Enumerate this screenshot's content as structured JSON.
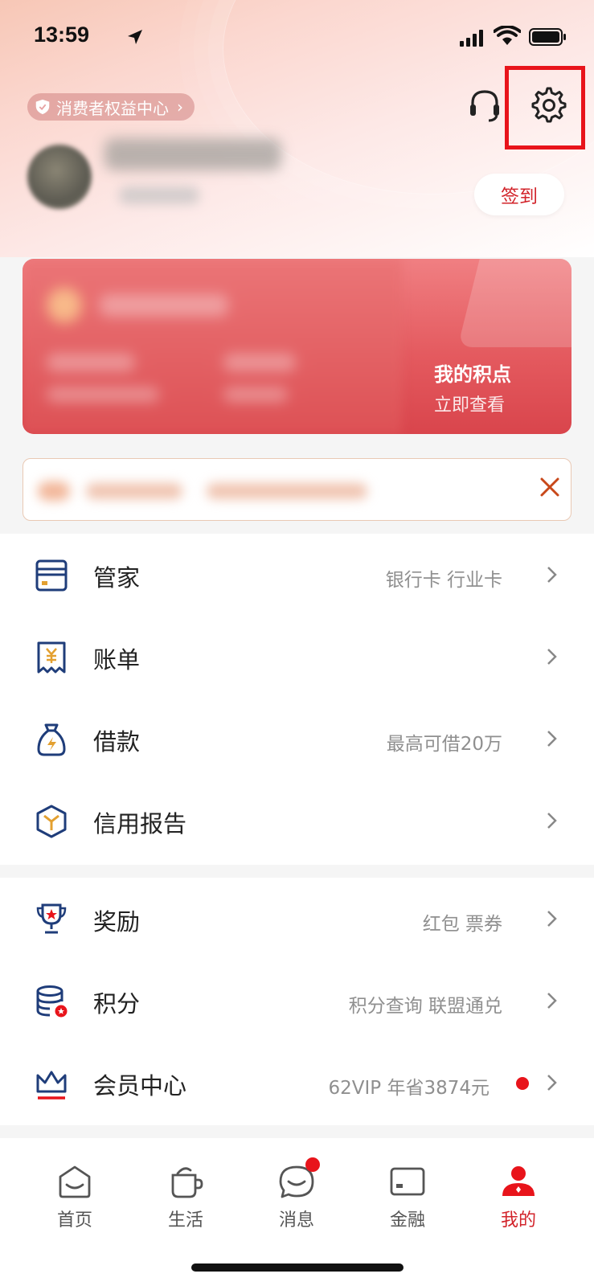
{
  "status_bar": {
    "time": "13:59"
  },
  "header": {
    "consumer_badge": "消费者权益中心",
    "checkin_label": "签到"
  },
  "points_card": {
    "title": "我的积点",
    "subtitle": "立即查看"
  },
  "menu_group_1": [
    {
      "label": "管家",
      "sub": "银行卡 行业卡",
      "icon": "card-icon"
    },
    {
      "label": "账单",
      "sub": "",
      "icon": "bill-icon"
    },
    {
      "label": "借款",
      "sub": "最高可借20万",
      "icon": "loan-bag-icon"
    },
    {
      "label": "信用报告",
      "sub": "",
      "icon": "credit-report-icon"
    }
  ],
  "menu_group_2": [
    {
      "label": "奖励",
      "sub": "红包 票券",
      "icon": "trophy-icon"
    },
    {
      "label": "积分",
      "sub": "积分查询 联盟通兑",
      "icon": "points-coins-icon"
    },
    {
      "label": "会员中心",
      "sub": "62VIP 年省3874元",
      "icon": "crown-icon",
      "has_dot": true
    }
  ],
  "tabs": [
    {
      "label": "首页",
      "icon": "home-icon",
      "active": false
    },
    {
      "label": "生活",
      "icon": "cup-icon",
      "active": false
    },
    {
      "label": "消息",
      "icon": "message-icon",
      "active": false,
      "badge": true
    },
    {
      "label": "金融",
      "icon": "finance-card-icon",
      "active": false
    },
    {
      "label": "我的",
      "icon": "profile-icon",
      "active": true
    }
  ],
  "colors": {
    "brand_red": "#d2232a",
    "highlight_red": "#e8141b",
    "icon_blue": "#1f3d7a",
    "icon_gold": "#e3a030"
  }
}
